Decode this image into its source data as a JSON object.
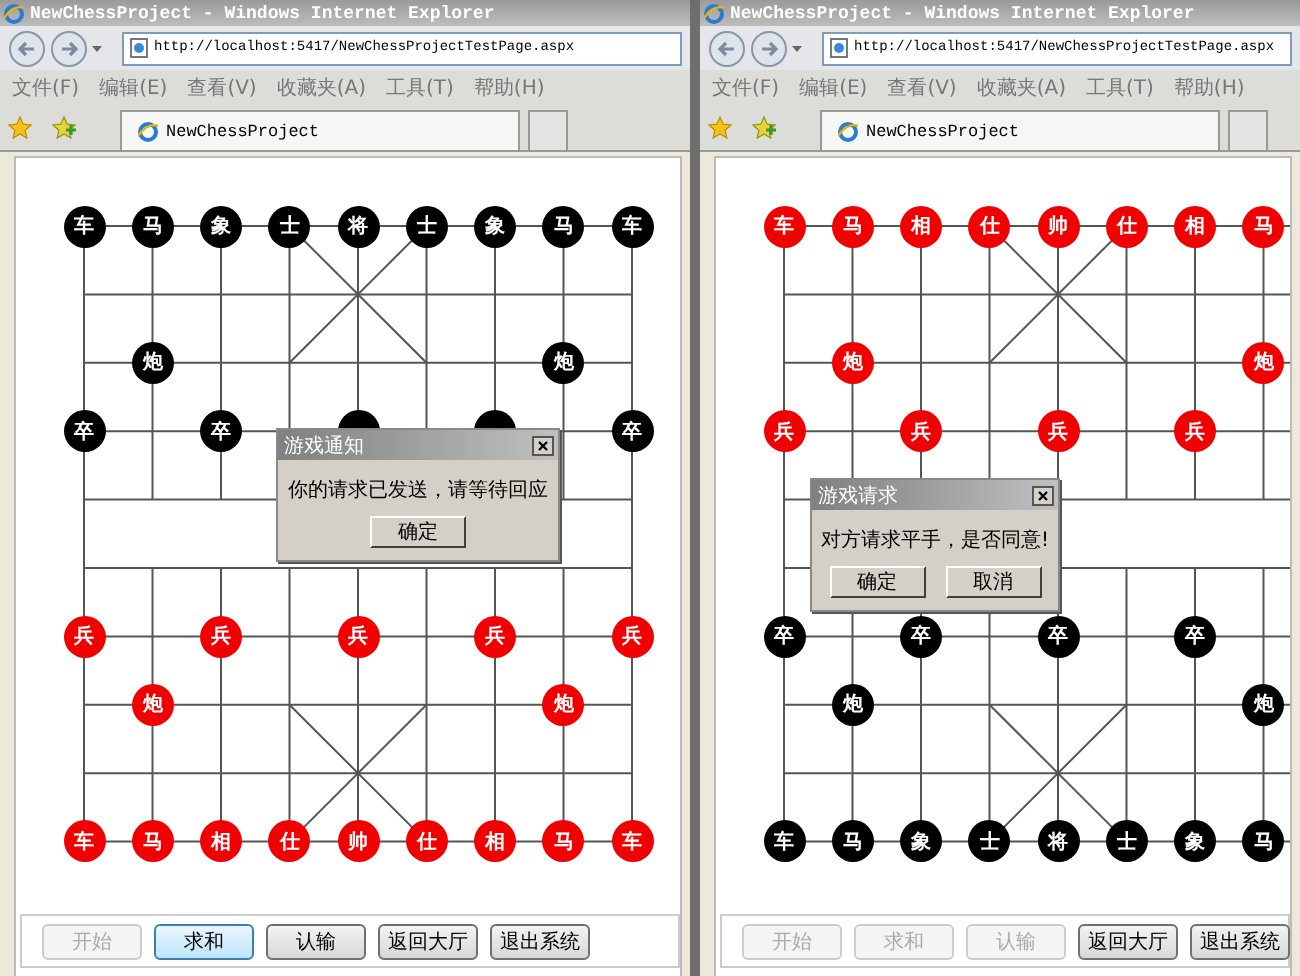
{
  "windows": [
    {
      "title": "NewChessProject - Windows Internet Explorer",
      "address": "http://localhost:5417/NewChessProjectTestPage.aspx",
      "menu": [
        "文件(F)",
        "编辑(E)",
        "查看(V)",
        "收藏夹(A)",
        "工具(T)",
        "帮助(H)"
      ],
      "tab": "NewChessProject",
      "board": [
        [
          {
            "kind": "piece",
            "color": "#000000",
            "label": "车"
          },
          {
            "kind": "piece",
            "color": "#000000",
            "label": "马"
          },
          {
            "kind": "piece",
            "color": "#000000",
            "label": "象"
          },
          {
            "kind": "piece",
            "color": "#000000",
            "label": "士"
          },
          {
            "kind": "piece",
            "color": "#000000",
            "label": "将"
          },
          {
            "kind": "piece",
            "color": "#000000",
            "label": "士"
          },
          {
            "kind": "piece",
            "color": "#000000",
            "label": "象"
          },
          {
            "kind": "piece",
            "color": "#000000",
            "label": "马"
          },
          {
            "kind": "piece",
            "color": "#000000",
            "label": "车"
          }
        ],
        [
          {
            "kind": "point"
          },
          {
            "kind": "point"
          },
          {
            "kind": "point"
          },
          {
            "kind": "point"
          },
          {
            "kind": "point"
          },
          {
            "kind": "point"
          },
          {
            "kind": "point"
          },
          {
            "kind": "point"
          },
          {
            "kind": "point"
          }
        ],
        [
          {
            "kind": "point"
          },
          {
            "kind": "piece",
            "color": "#000000",
            "label": "炮"
          },
          {
            "kind": "point"
          },
          {
            "kind": "point"
          },
          {
            "kind": "point"
          },
          {
            "kind": "point"
          },
          {
            "kind": "point"
          },
          {
            "kind": "piece",
            "color": "#000000",
            "label": "炮"
          },
          {
            "kind": "point"
          }
        ],
        [
          {
            "kind": "piece",
            "color": "#000000",
            "label": "卒"
          },
          {
            "kind": "point"
          },
          {
            "kind": "piece",
            "color": "#000000",
            "label": "卒"
          },
          {
            "kind": "point"
          },
          {
            "kind": "piece",
            "color": "#000000"
          },
          {
            "kind": "point"
          },
          {
            "kind": "piece",
            "color": "#000000"
          },
          {
            "kind": "point"
          },
          {
            "kind": "piece",
            "color": "#000000",
            "label": "卒"
          }
        ],
        [
          {
            "kind": "point"
          },
          {
            "kind": "point"
          },
          {
            "kind": "point"
          },
          {
            "kind": "point"
          },
          {
            "kind": "point"
          },
          {
            "kind": "point"
          },
          {
            "kind": "point"
          },
          {
            "kind": "point"
          },
          {
            "kind": "point"
          }
        ],
        [
          {
            "kind": "point"
          },
          {
            "kind": "point"
          },
          {
            "kind": "point"
          },
          {
            "kind": "point"
          },
          {
            "kind": "point"
          },
          {
            "kind": "point"
          },
          {
            "kind": "point"
          },
          {
            "kind": "point"
          },
          {
            "kind": "point"
          }
        ],
        [
          {
            "kind": "piece",
            "color": "#f00000",
            "label": "兵"
          },
          {
            "kind": "point"
          },
          {
            "kind": "piece",
            "color": "#f00000",
            "label": "兵"
          },
          {
            "kind": "point"
          },
          {
            "kind": "piece",
            "color": "#f00000",
            "label": "兵"
          },
          {
            "kind": "point"
          },
          {
            "kind": "piece",
            "color": "#f00000",
            "label": "兵"
          },
          {
            "kind": "point"
          },
          {
            "kind": "piece",
            "color": "#f00000",
            "label": "兵"
          }
        ],
        [
          {
            "kind": "point"
          },
          {
            "kind": "piece",
            "color": "#f00000",
            "label": "炮"
          },
          {
            "kind": "point"
          },
          {
            "kind": "point"
          },
          {
            "kind": "point"
          },
          {
            "kind": "point"
          },
          {
            "kind": "point"
          },
          {
            "kind": "piece",
            "color": "#f00000",
            "label": "炮"
          },
          {
            "kind": "point"
          }
        ],
        [
          {
            "kind": "point"
          },
          {
            "kind": "point"
          },
          {
            "kind": "point"
          },
          {
            "kind": "point"
          },
          {
            "kind": "point"
          },
          {
            "kind": "point"
          },
          {
            "kind": "point"
          },
          {
            "kind": "point"
          },
          {
            "kind": "point"
          }
        ],
        [
          {
            "kind": "piece",
            "color": "#f00000",
            "label": "车"
          },
          {
            "kind": "piece",
            "color": "#f00000",
            "label": "马"
          },
          {
            "kind": "piece",
            "color": "#f00000",
            "label": "相"
          },
          {
            "kind": "piece",
            "color": "#f00000",
            "label": "仕"
          },
          {
            "kind": "piece",
            "color": "#f00000",
            "label": "帅"
          },
          {
            "kind": "piece",
            "color": "#f00000",
            "label": "仕"
          },
          {
            "kind": "piece",
            "color": "#f00000",
            "label": "相"
          },
          {
            "kind": "piece",
            "color": "#f00000",
            "label": "马"
          },
          {
            "kind": "piece",
            "color": "#f00000",
            "label": "车"
          }
        ]
      ],
      "dialog": {
        "title": "游戏通知",
        "message": "你的请求已发送，请等待回应",
        "buttons": [
          "确定"
        ]
      },
      "buttons": [
        {
          "label": "开始",
          "disabled": true,
          "focused": false
        },
        {
          "label": "求和",
          "disabled": false,
          "focused": true
        },
        {
          "label": "认输",
          "disabled": false,
          "focused": false
        },
        {
          "label": "返回大厅",
          "disabled": false,
          "focused": false
        },
        {
          "label": "退出系统",
          "disabled": false,
          "focused": false
        }
      ]
    },
    {
      "title": "NewChessProject - Windows Internet Explorer",
      "address": "http://localhost:5417/NewChessProjectTestPage.aspx",
      "menu": [
        "文件(F)",
        "编辑(E)",
        "查看(V)",
        "收藏夹(A)",
        "工具(T)",
        "帮助(H)"
      ],
      "tab": "NewChessProject",
      "board": [
        [
          {
            "kind": "piece",
            "color": "#f00000",
            "label": "车"
          },
          {
            "kind": "piece",
            "color": "#f00000",
            "label": "马"
          },
          {
            "kind": "piece",
            "color": "#f00000",
            "label": "相"
          },
          {
            "kind": "piece",
            "color": "#f00000",
            "label": "仕"
          },
          {
            "kind": "piece",
            "color": "#f00000",
            "label": "帅"
          },
          {
            "kind": "piece",
            "color": "#f00000",
            "label": "仕"
          },
          {
            "kind": "piece",
            "color": "#f00000",
            "label": "相"
          },
          {
            "kind": "piece",
            "color": "#f00000",
            "label": "马"
          }
        ],
        [
          {
            "kind": "point"
          },
          {
            "kind": "point"
          },
          {
            "kind": "point"
          },
          {
            "kind": "point"
          },
          {
            "kind": "point"
          },
          {
            "kind": "point"
          },
          {
            "kind": "point"
          },
          {
            "kind": "point"
          }
        ],
        [
          {
            "kind": "point"
          },
          {
            "kind": "piece",
            "color": "#f00000",
            "label": "炮"
          },
          {
            "kind": "point"
          },
          {
            "kind": "point"
          },
          {
            "kind": "point"
          },
          {
            "kind": "point"
          },
          {
            "kind": "point"
          },
          {
            "kind": "piece",
            "color": "#f00000",
            "label": "炮"
          }
        ],
        [
          {
            "kind": "piece",
            "color": "#f00000",
            "label": "兵"
          },
          {
            "kind": "point"
          },
          {
            "kind": "piece",
            "color": "#f00000",
            "label": "兵"
          },
          {
            "kind": "point"
          },
          {
            "kind": "piece",
            "color": "#f00000",
            "label": "兵"
          },
          {
            "kind": "point"
          },
          {
            "kind": "piece",
            "color": "#f00000",
            "label": "兵"
          },
          {
            "kind": "point"
          }
        ],
        [
          {
            "kind": "point"
          },
          {
            "kind": "point"
          },
          {
            "kind": "point"
          },
          {
            "kind": "point"
          },
          {
            "kind": "point"
          },
          {
            "kind": "point"
          },
          {
            "kind": "point"
          },
          {
            "kind": "point"
          }
        ],
        [
          {
            "kind": "point"
          },
          {
            "kind": "point"
          },
          {
            "kind": "point"
          },
          {
            "kind": "point"
          },
          {
            "kind": "point"
          },
          {
            "kind": "point"
          },
          {
            "kind": "point"
          },
          {
            "kind": "point"
          }
        ],
        [
          {
            "kind": "piece",
            "color": "#000000",
            "label": "卒"
          },
          {
            "kind": "point"
          },
          {
            "kind": "piece",
            "color": "#000000",
            "label": "卒"
          },
          {
            "kind": "point"
          },
          {
            "kind": "piece",
            "color": "#000000",
            "label": "卒"
          },
          {
            "kind": "point"
          },
          {
            "kind": "piece",
            "color": "#000000",
            "label": "卒"
          },
          {
            "kind": "point"
          }
        ],
        [
          {
            "kind": "point"
          },
          {
            "kind": "piece",
            "color": "#000000",
            "label": "炮"
          },
          {
            "kind": "point"
          },
          {
            "kind": "point"
          },
          {
            "kind": "point"
          },
          {
            "kind": "point"
          },
          {
            "kind": "point"
          },
          {
            "kind": "piece",
            "color": "#000000",
            "label": "炮"
          }
        ],
        [
          {
            "kind": "point"
          },
          {
            "kind": "point"
          },
          {
            "kind": "point"
          },
          {
            "kind": "point"
          },
          {
            "kind": "point"
          },
          {
            "kind": "point"
          },
          {
            "kind": "point"
          },
          {
            "kind": "point"
          }
        ],
        [
          {
            "kind": "piece",
            "color": "#000000",
            "label": "车"
          },
          {
            "kind": "piece",
            "color": "#000000",
            "label": "马"
          },
          {
            "kind": "piece",
            "color": "#000000",
            "label": "象"
          },
          {
            "kind": "piece",
            "color": "#000000",
            "label": "士"
          },
          {
            "kind": "piece",
            "color": "#000000",
            "label": "将"
          },
          {
            "kind": "piece",
            "color": "#000000",
            "label": "士"
          },
          {
            "kind": "piece",
            "color": "#000000",
            "label": "象"
          },
          {
            "kind": "piece",
            "color": "#000000",
            "label": "马"
          }
        ]
      ],
      "dialog": {
        "title": "游戏请求",
        "message": "对方请求平手，是否同意!",
        "buttons": [
          "确定",
          "取消"
        ]
      },
      "buttons": [
        {
          "label": "开始",
          "disabled": true,
          "focused": false
        },
        {
          "label": "求和",
          "disabled": true,
          "focused": false
        },
        {
          "label": "认输",
          "disabled": true,
          "focused": false
        },
        {
          "label": "返回大厅",
          "disabled": false,
          "focused": false
        },
        {
          "label": "退出系统",
          "disabled": false,
          "focused": false
        }
      ]
    }
  ]
}
